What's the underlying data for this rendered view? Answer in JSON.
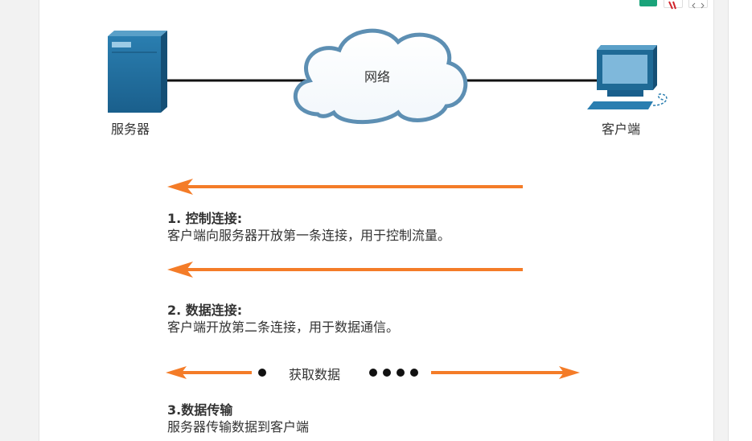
{
  "diagram": {
    "server_label": "服务器",
    "network_label": "网络",
    "client_label": "客户端"
  },
  "steps": [
    {
      "title": "1. 控制连接:",
      "text": "客户端向服务器开放第一条连接，用于控制流量。"
    },
    {
      "title": "2. 数据连接:",
      "text": "客户端开放第二条连接，用于数据通信。"
    },
    {
      "title": "3.数据传输",
      "text": "服务器传输数据到客户端"
    }
  ],
  "transfer_label": "获取数据",
  "colors": {
    "arrow": "#f47c28",
    "device": "#1f6a96",
    "cloud_stroke": "#5d8fb3",
    "text": "#333333"
  },
  "toolbar_icons": [
    "book-icon",
    "pdf-icon",
    "expand-icon"
  ]
}
